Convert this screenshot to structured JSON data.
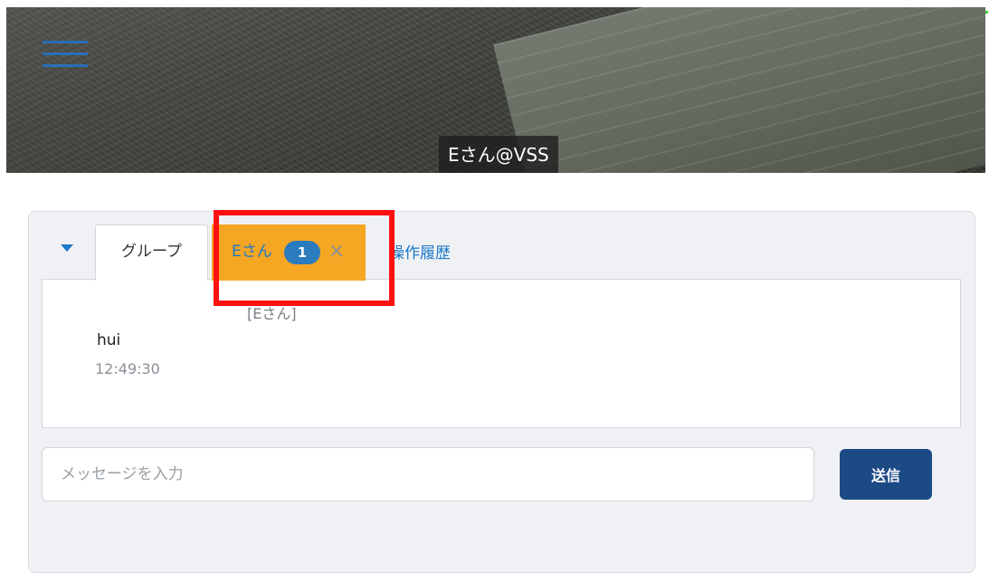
{
  "video": {
    "participant_label": "Eさん@VSS",
    "menu_icon": "hamburger-menu-icon"
  },
  "chat": {
    "collapse_icon": "triangle-down-icon",
    "tabs": [
      {
        "label": "グループ",
        "selected": true
      },
      {
        "label": "Eさん",
        "unread_count": "1",
        "close_symbol": "×",
        "highlighted_color": "#f5a623"
      },
      {
        "label": "操作履歴"
      }
    ],
    "messages": [
      {
        "sender": "[Eさん]",
        "text": "hui",
        "time": "12:49:30"
      }
    ],
    "input": {
      "placeholder": "メッセージを入力",
      "value": ""
    },
    "send_label": "送信"
  },
  "colors": {
    "accent": "#1e78c8",
    "send_button": "#1c4a85",
    "private_tab_bg": "#f5a623",
    "annotation_box": "#ff1010"
  }
}
